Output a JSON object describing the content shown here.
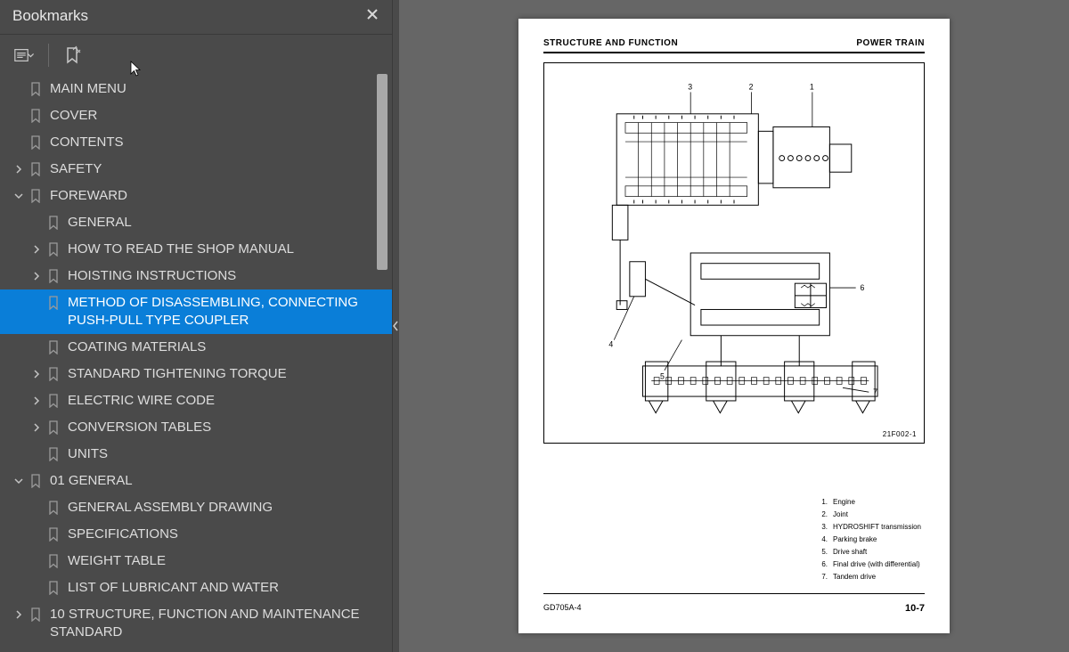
{
  "sidebar": {
    "title": "Bookmarks",
    "items": [
      {
        "label": "MAIN MENU",
        "indent": 0,
        "chev": "none"
      },
      {
        "label": "COVER",
        "indent": 0,
        "chev": "none"
      },
      {
        "label": "CONTENTS",
        "indent": 0,
        "chev": "none"
      },
      {
        "label": "SAFETY",
        "indent": 0,
        "chev": "right"
      },
      {
        "label": "FOREWARD",
        "indent": 0,
        "chev": "down"
      },
      {
        "label": "GENERAL",
        "indent": 1,
        "chev": "none"
      },
      {
        "label": "HOW TO READ THE SHOP MANUAL",
        "indent": 1,
        "chev": "right"
      },
      {
        "label": "HOISTING INSTRUCTIONS",
        "indent": 1,
        "chev": "right"
      },
      {
        "label": "METHOD OF DISASSEMBLING, CONNECTING PUSH-PULL TYPE COUPLER",
        "indent": 1,
        "chev": "none",
        "selected": true
      },
      {
        "label": "COATING MATERIALS",
        "indent": 1,
        "chev": "none"
      },
      {
        "label": "STANDARD TIGHTENING TORQUE",
        "indent": 1,
        "chev": "right"
      },
      {
        "label": "ELECTRIC WIRE CODE",
        "indent": 1,
        "chev": "right"
      },
      {
        "label": "CONVERSION TABLES",
        "indent": 1,
        "chev": "right"
      },
      {
        "label": "UNITS",
        "indent": 1,
        "chev": "none"
      },
      {
        "label": "01 GENERAL",
        "indent": 0,
        "chev": "down"
      },
      {
        "label": "GENERAL ASSEMBLY DRAWING",
        "indent": 1,
        "chev": "none"
      },
      {
        "label": "SPECIFICATIONS",
        "indent": 1,
        "chev": "none"
      },
      {
        "label": "WEIGHT TABLE",
        "indent": 1,
        "chev": "none"
      },
      {
        "label": "LIST OF LUBRICANT AND WATER",
        "indent": 1,
        "chev": "none"
      },
      {
        "label": "10 STRUCTURE, FUNCTION AND MAINTENANCE STANDARD",
        "indent": 0,
        "chev": "right"
      }
    ]
  },
  "page": {
    "header_left": "STRUCTURE AND FUNCTION",
    "header_right": "POWER TRAIN",
    "diagram_ref": "21F002-1",
    "legend": [
      {
        "n": "1.",
        "t": "Engine"
      },
      {
        "n": "2.",
        "t": "Joint"
      },
      {
        "n": "3.",
        "t": "HYDROSHIFT transmission"
      },
      {
        "n": "4.",
        "t": "Parking brake"
      },
      {
        "n": "5.",
        "t": "Drive shaft"
      },
      {
        "n": "6.",
        "t": "Final drive (with differential)"
      },
      {
        "n": "7.",
        "t": "Tandem drive"
      }
    ],
    "footer_left": "GD705A-4",
    "footer_right": "10-7"
  }
}
